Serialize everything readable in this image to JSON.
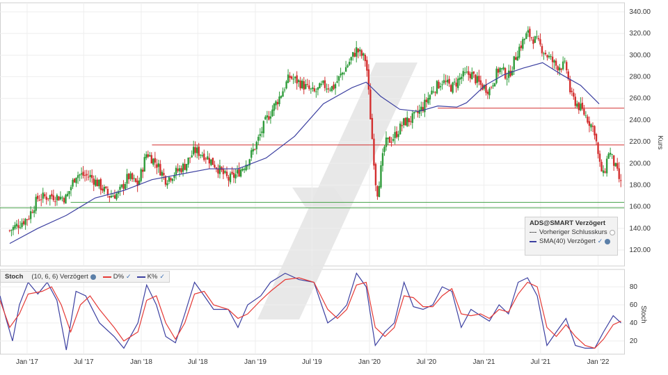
{
  "chart_data": [
    {
      "type": "candlestick",
      "title": "ADS@SMART Verzögert",
      "ylabel": "Kurs",
      "ylim": [
        100,
        345
      ],
      "y_ticks": [
        "120.00",
        "140.00",
        "160.00",
        "180.00",
        "200.00",
        "220.00",
        "240.00",
        "260.00",
        "280.00",
        "300.00",
        "320.00",
        "340.00"
      ],
      "x_ticks": [
        "Jan '17",
        "Jul '17",
        "Jan '18",
        "Jul '18",
        "Jan '19",
        "Jul '19",
        "Jan '20",
        "Jul '20",
        "Jan '21",
        "Jul '21",
        "Jan '22"
      ],
      "price_path": [
        [
          "2017-01-01",
          138
        ],
        [
          "2017-03-01",
          150
        ],
        [
          "2017-04-01",
          168
        ],
        [
          "2017-05-15",
          170
        ],
        [
          "2017-07-01",
          168
        ],
        [
          "2017-08-01",
          190
        ],
        [
          "2017-09-15",
          188
        ],
        [
          "2017-10-15",
          180
        ],
        [
          "2017-11-15",
          170
        ],
        [
          "2017-12-15",
          172
        ],
        [
          "2018-01-15",
          188
        ],
        [
          "2018-02-15",
          180
        ],
        [
          "2018-03-15",
          210
        ],
        [
          "2018-04-15",
          200
        ],
        [
          "2018-05-15",
          185
        ],
        [
          "2018-07-15",
          198
        ],
        [
          "2018-08-15",
          212
        ],
        [
          "2018-09-15",
          208
        ],
        [
          "2018-10-15",
          200
        ],
        [
          "2018-12-01",
          185
        ],
        [
          "2018-12-28",
          190
        ],
        [
          "2019-02-01",
          202
        ],
        [
          "2019-03-01",
          218
        ],
        [
          "2019-04-01",
          240
        ],
        [
          "2019-05-15",
          262
        ],
        [
          "2019-06-15",
          280
        ],
        [
          "2019-07-15",
          275
        ],
        [
          "2019-09-01",
          265
        ],
        [
          "2019-10-01",
          272
        ],
        [
          "2019-11-01",
          270
        ],
        [
          "2019-12-15",
          290
        ],
        [
          "2020-01-15",
          305
        ],
        [
          "2020-02-15",
          295
        ],
        [
          "2020-03-01",
          238
        ],
        [
          "2020-03-20",
          170
        ],
        [
          "2020-04-15",
          218
        ],
        [
          "2020-05-15",
          225
        ],
        [
          "2020-06-15",
          238
        ],
        [
          "2020-07-15",
          242
        ],
        [
          "2020-08-15",
          252
        ],
        [
          "2020-09-15",
          268
        ],
        [
          "2020-10-15",
          276
        ],
        [
          "2020-11-15",
          270
        ],
        [
          "2020-12-15",
          280
        ],
        [
          "2021-01-15",
          283
        ],
        [
          "2021-02-15",
          272
        ],
        [
          "2021-03-15",
          268
        ],
        [
          "2021-04-15",
          288
        ],
        [
          "2021-05-15",
          280
        ],
        [
          "2021-06-15",
          305
        ],
        [
          "2021-07-15",
          320
        ],
        [
          "2021-08-15",
          312
        ],
        [
          "2021-09-15",
          300
        ],
        [
          "2021-10-15",
          290
        ],
        [
          "2021-11-15",
          290
        ],
        [
          "2021-12-01",
          262
        ],
        [
          "2021-12-20",
          255
        ],
        [
          "2022-01-15",
          245
        ],
        [
          "2022-02-15",
          230
        ],
        [
          "2022-03-01",
          200
        ],
        [
          "2022-03-15",
          188
        ],
        [
          "2022-04-01",
          212
        ],
        [
          "2022-04-20",
          198
        ],
        [
          "2022-05-10",
          180
        ]
      ],
      "sma": {
        "name": "SMA(40) Verzögert",
        "values": [
          [
            "2017-01-01",
            126
          ],
          [
            "2017-04-01",
            140
          ],
          [
            "2017-07-01",
            152
          ],
          [
            "2017-10-01",
            168
          ],
          [
            "2018-01-01",
            175
          ],
          [
            "2018-04-01",
            185
          ],
          [
            "2018-07-01",
            190
          ],
          [
            "2018-10-01",
            195
          ],
          [
            "2019-01-01",
            195
          ],
          [
            "2019-04-01",
            205
          ],
          [
            "2019-07-01",
            225
          ],
          [
            "2019-10-01",
            255
          ],
          [
            "2020-01-01",
            270
          ],
          [
            "2020-02-15",
            275
          ],
          [
            "2020-04-01",
            262
          ],
          [
            "2020-06-01",
            250
          ],
          [
            "2020-08-01",
            248
          ],
          [
            "2020-10-01",
            253
          ],
          [
            "2020-12-01",
            252
          ],
          [
            "2021-01-01",
            256
          ],
          [
            "2021-03-01",
            272
          ],
          [
            "2021-05-01",
            282
          ],
          [
            "2021-07-01",
            288
          ],
          [
            "2021-09-01",
            293
          ],
          [
            "2021-11-01",
            282
          ],
          [
            "2022-01-01",
            272
          ],
          [
            "2022-03-01",
            255
          ]
        ]
      },
      "horizontal_lines": [
        {
          "y": 251,
          "start": "2020-10-01",
          "color": "#d32f2f"
        },
        {
          "y": 217,
          "start": "2018-04-01",
          "color": "#d32f2f"
        },
        {
          "y": 164,
          "start": "2017-07-15",
          "color": "#43a047"
        },
        {
          "y": 159,
          "start": "2016-12-01",
          "color": "#43a047"
        }
      ],
      "legend": {
        "title": "ADS@SMART Verzögert",
        "items": [
          "Vorheriger Schlusskurs",
          "SMA(40) Verzögert"
        ]
      }
    },
    {
      "type": "line",
      "title": "Stoch",
      "ylabel": "Stoch",
      "ylim": [
        0,
        100
      ],
      "y_ticks": [
        "20",
        "40",
        "60",
        "80"
      ],
      "params": "(10, 6, 6) Verzögert",
      "series": [
        {
          "name": "K%",
          "color": "#3b3fa0",
          "values": [
            [
              "2016-12-01",
              70
            ],
            [
              "2016-12-20",
              45
            ],
            [
              "2017-01-10",
              20
            ],
            [
              "2017-02-01",
              60
            ],
            [
              "2017-03-01",
              85
            ],
            [
              "2017-04-01",
              72
            ],
            [
              "2017-05-01",
              85
            ],
            [
              "2017-06-01",
              65
            ],
            [
              "2017-07-01",
              10
            ],
            [
              "2017-08-01",
              75
            ],
            [
              "2017-09-01",
              70
            ],
            [
              "2017-10-15",
              40
            ],
            [
              "2017-12-01",
              25
            ],
            [
              "2018-01-01",
              12
            ],
            [
              "2018-02-15",
              40
            ],
            [
              "2018-03-15",
              82
            ],
            [
              "2018-04-15",
              60
            ],
            [
              "2018-05-15",
              25
            ],
            [
              "2018-06-15",
              18
            ],
            [
              "2018-07-15",
              50
            ],
            [
              "2018-08-15",
              85
            ],
            [
              "2018-09-15",
              70
            ],
            [
              "2018-10-15",
              55
            ],
            [
              "2018-12-01",
              55
            ],
            [
              "2019-01-01",
              35
            ],
            [
              "2019-02-01",
              60
            ],
            [
              "2019-03-15",
              70
            ],
            [
              "2019-04-15",
              85
            ],
            [
              "2019-06-01",
              95
            ],
            [
              "2019-07-15",
              88
            ],
            [
              "2019-09-01",
              85
            ],
            [
              "2019-10-15",
              40
            ],
            [
              "2019-11-15",
              48
            ],
            [
              "2019-12-15",
              60
            ],
            [
              "2020-01-15",
              95
            ],
            [
              "2020-02-15",
              80
            ],
            [
              "2020-03-15",
              15
            ],
            [
              "2020-04-15",
              30
            ],
            [
              "2020-05-15",
              40
            ],
            [
              "2020-06-15",
              85
            ],
            [
              "2020-07-15",
              58
            ],
            [
              "2020-08-15",
              55
            ],
            [
              "2020-09-15",
              60
            ],
            [
              "2020-10-15",
              80
            ],
            [
              "2020-11-15",
              75
            ],
            [
              "2020-12-15",
              35
            ],
            [
              "2021-01-15",
              55
            ],
            [
              "2021-02-15",
              48
            ],
            [
              "2021-03-15",
              42
            ],
            [
              "2021-04-15",
              60
            ],
            [
              "2021-05-15",
              50
            ],
            [
              "2021-06-15",
              85
            ],
            [
              "2021-07-15",
              90
            ],
            [
              "2021-08-15",
              70
            ],
            [
              "2021-09-15",
              15
            ],
            [
              "2021-10-15",
              30
            ],
            [
              "2021-11-15",
              45
            ],
            [
              "2021-12-15",
              15
            ],
            [
              "2022-01-15",
              12
            ],
            [
              "2022-02-15",
              12
            ],
            [
              "2022-03-15",
              30
            ],
            [
              "2022-04-15",
              48
            ],
            [
              "2022-05-10",
              40
            ]
          ]
        },
        {
          "name": "D%",
          "color": "#e53935",
          "values": [
            [
              "2016-12-01",
              65
            ],
            [
              "2017-01-01",
              35
            ],
            [
              "2017-02-01",
              50
            ],
            [
              "2017-03-01",
              72
            ],
            [
              "2017-04-15",
              75
            ],
            [
              "2017-05-15",
              80
            ],
            [
              "2017-06-15",
              60
            ],
            [
              "2017-07-15",
              30
            ],
            [
              "2017-08-15",
              60
            ],
            [
              "2017-09-15",
              70
            ],
            [
              "2017-10-15",
              55
            ],
            [
              "2017-12-01",
              35
            ],
            [
              "2018-01-01",
              20
            ],
            [
              "2018-02-15",
              30
            ],
            [
              "2018-03-15",
              65
            ],
            [
              "2018-04-15",
              70
            ],
            [
              "2018-05-15",
              40
            ],
            [
              "2018-06-15",
              22
            ],
            [
              "2018-07-15",
              40
            ],
            [
              "2018-08-15",
              72
            ],
            [
              "2018-09-15",
              75
            ],
            [
              "2018-10-15",
              60
            ],
            [
              "2018-12-01",
              55
            ],
            [
              "2019-01-01",
              45
            ],
            [
              "2019-02-01",
              50
            ],
            [
              "2019-03-15",
              65
            ],
            [
              "2019-04-15",
              75
            ],
            [
              "2019-06-01",
              88
            ],
            [
              "2019-07-15",
              90
            ],
            [
              "2019-09-01",
              85
            ],
            [
              "2019-10-15",
              55
            ],
            [
              "2019-11-15",
              45
            ],
            [
              "2019-12-15",
              55
            ],
            [
              "2020-01-15",
              82
            ],
            [
              "2020-02-15",
              85
            ],
            [
              "2020-03-15",
              35
            ],
            [
              "2020-04-15",
              25
            ],
            [
              "2020-05-15",
              35
            ],
            [
              "2020-06-15",
              70
            ],
            [
              "2020-07-15",
              68
            ],
            [
              "2020-08-15",
              58
            ],
            [
              "2020-09-15",
              58
            ],
            [
              "2020-10-15",
              70
            ],
            [
              "2020-11-15",
              78
            ],
            [
              "2020-12-15",
              50
            ],
            [
              "2021-01-15",
              48
            ],
            [
              "2021-02-15",
              50
            ],
            [
              "2021-03-15",
              45
            ],
            [
              "2021-04-15",
              55
            ],
            [
              "2021-05-15",
              52
            ],
            [
              "2021-06-15",
              72
            ],
            [
              "2021-07-15",
              85
            ],
            [
              "2021-08-15",
              80
            ],
            [
              "2021-09-15",
              35
            ],
            [
              "2021-10-15",
              25
            ],
            [
              "2021-11-15",
              38
            ],
            [
              "2021-12-15",
              25
            ],
            [
              "2022-01-15",
              15
            ],
            [
              "2022-02-15",
              12
            ],
            [
              "2022-03-15",
              22
            ],
            [
              "2022-04-15",
              38
            ],
            [
              "2022-05-10",
              42
            ]
          ]
        }
      ]
    }
  ],
  "ui": {
    "legend_icon": "globe-icon",
    "watermark": "zigzag-watermark"
  }
}
